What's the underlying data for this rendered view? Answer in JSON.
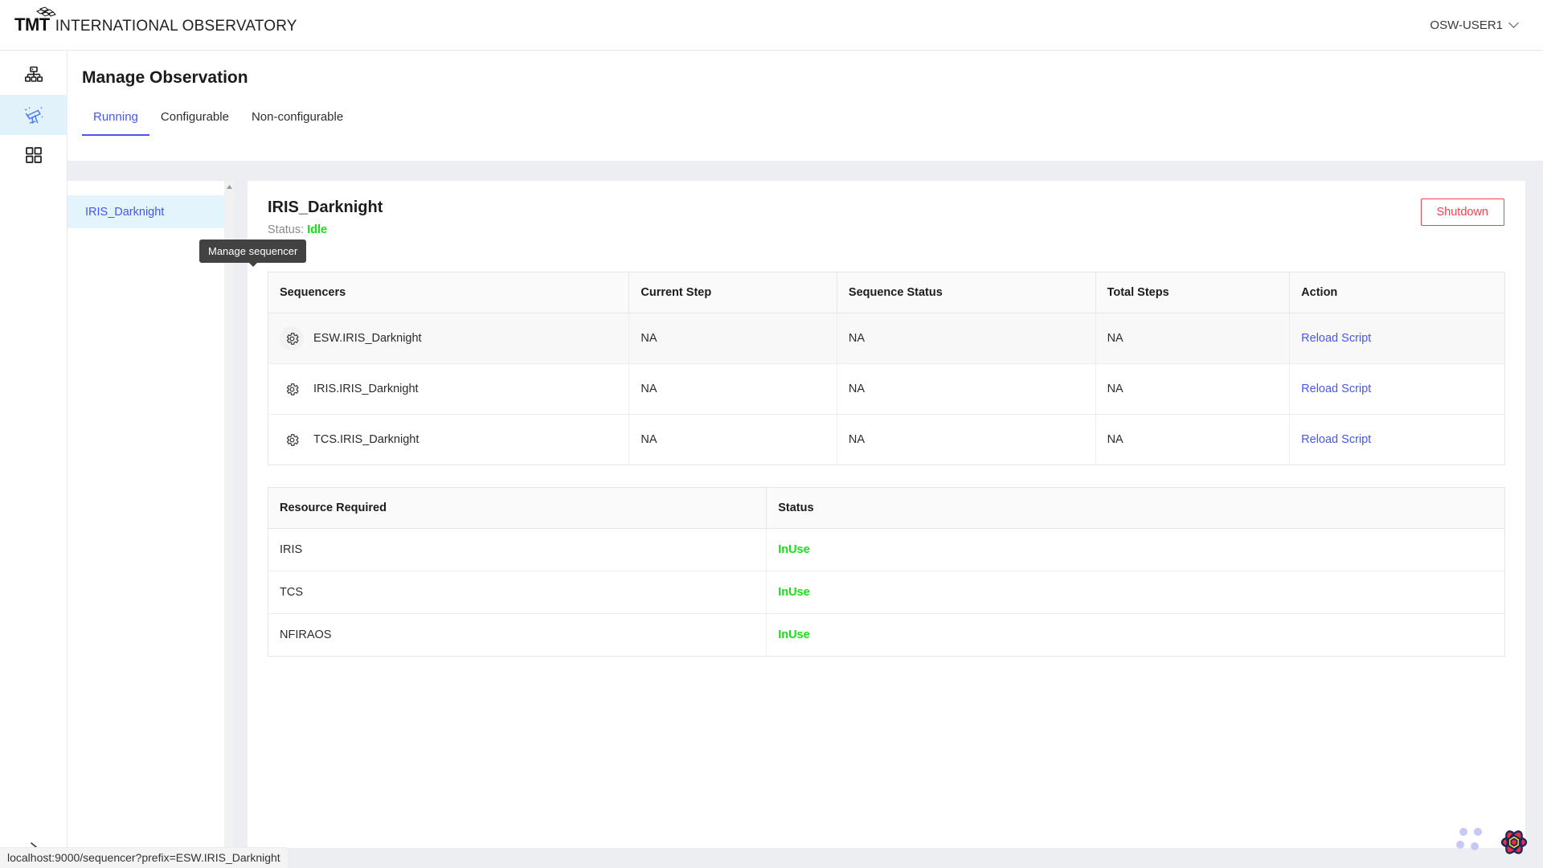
{
  "header": {
    "brand_mark": "TMT",
    "brand_text": "INTERNATIONAL OBSERVATORY",
    "logo_icon": "tmt-tiles-icon",
    "user": "OSW-USER1",
    "user_chevron_icon": "chevron-down-icon"
  },
  "rail": {
    "items": [
      {
        "icon": "hierarchy-icon",
        "name": "resources",
        "active": false
      },
      {
        "icon": "telescope-icon",
        "name": "observations",
        "active": true
      },
      {
        "icon": "grid-apps-icon",
        "name": "apps",
        "active": false
      }
    ],
    "expand_icon": "chevron-right-icon"
  },
  "page": {
    "title": "Manage Observation",
    "tabs": [
      {
        "label": "Running",
        "active": true
      },
      {
        "label": "Configurable",
        "active": false
      },
      {
        "label": "Non-configurable",
        "active": false
      }
    ]
  },
  "obs_list": {
    "items": [
      {
        "label": "IRIS_Darknight",
        "selected": true
      }
    ],
    "scroll_up_icon": "scroll-up-arrow-icon"
  },
  "card": {
    "name": "IRIS_Darknight",
    "status_label": "Status:",
    "status_value": "Idle",
    "shutdown_label": "Shutdown"
  },
  "tooltip": {
    "text": "Manage sequencer"
  },
  "sequencers_table": {
    "columns": [
      "Sequencers",
      "Current Step",
      "Sequence Status",
      "Total Steps",
      "Action"
    ],
    "rows": [
      {
        "icon": "gear-icon",
        "sequencer": "ESW.IRIS_Darknight",
        "current_step": "NA",
        "sequence_status": "NA",
        "total_steps": "NA",
        "action": "Reload Script",
        "hovered": true
      },
      {
        "icon": "gear-icon",
        "sequencer": "IRIS.IRIS_Darknight",
        "current_step": "NA",
        "sequence_status": "NA",
        "total_steps": "NA",
        "action": "Reload Script",
        "hovered": false
      },
      {
        "icon": "gear-icon",
        "sequencer": "TCS.IRIS_Darknight",
        "current_step": "NA",
        "sequence_status": "NA",
        "total_steps": "NA",
        "action": "Reload Script",
        "hovered": false
      }
    ]
  },
  "resources_table": {
    "columns": [
      "Resource Required",
      "Status"
    ],
    "rows": [
      {
        "resource": "IRIS",
        "status": "InUse"
      },
      {
        "resource": "TCS",
        "status": "InUse"
      },
      {
        "resource": "NFIRAOS",
        "status": "InUse"
      }
    ]
  },
  "statusbar": {
    "url": "localhost:9000/sequencer?prefix=ESW.IRIS_Darknight"
  },
  "devtools": {
    "icon": "react-query-flower-icon"
  },
  "colors": {
    "accent_blue": "#4657ed",
    "danger_red": "#ff3b4e",
    "status_green": "#16e116",
    "rail_active_bg": "#e1f2fb",
    "list_selected_bg": "#e3f4fd",
    "content_bg": "#eceef1",
    "tooltip_bg": "#424242"
  }
}
